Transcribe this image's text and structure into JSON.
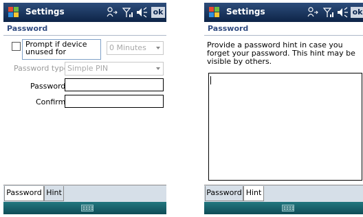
{
  "screens": [
    {
      "title": "Settings",
      "ok_label": "ok",
      "header": "Password",
      "prompt_label": "Prompt if device unused for",
      "prompt_checked": false,
      "prompt_minutes": "0 Minutes",
      "password_type_label": "Password type:",
      "password_type_value": "Simple PIN",
      "password_label": "Password:",
      "password_value": "",
      "confirm_label": "Confirm:",
      "confirm_value": "",
      "tabs": [
        {
          "label": "Password",
          "active": true
        },
        {
          "label": "Hint",
          "active": false
        }
      ]
    },
    {
      "title": "Settings",
      "ok_label": "ok",
      "header": "Password",
      "hint_instructions": "Provide a password hint in case you forget your password. This hint may be visible by others.",
      "hint_value": "",
      "tabs": [
        {
          "label": "Password",
          "active": false
        },
        {
          "label": "Hint",
          "active": true
        }
      ]
    }
  ],
  "colors": {
    "titlebar": "#1b3560",
    "header_text": "#2f4a80",
    "tabbar": "#d6dfe8",
    "sip_bar": "#1a6069"
  },
  "icons": [
    "windows-start-icon",
    "connectivity-icon",
    "signal-icon",
    "volume-icon",
    "keyboard-icon"
  ]
}
